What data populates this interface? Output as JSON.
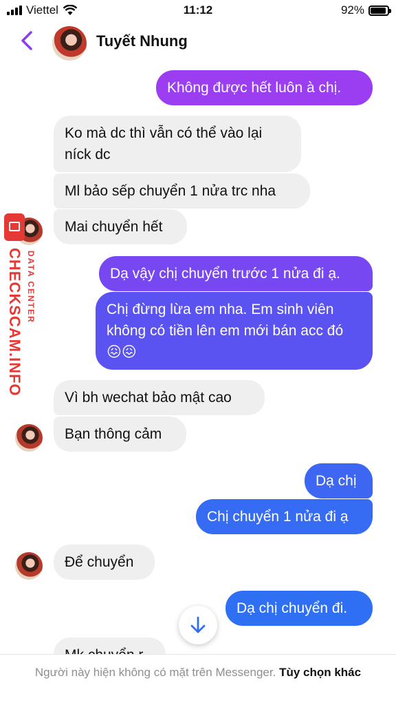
{
  "status_bar": {
    "carrier": "Viettel",
    "time": "11:12",
    "battery": "92%",
    "battery_level": 0.92
  },
  "header": {
    "contact_name": "Tuyết Nhung"
  },
  "watermark": {
    "main": "CHECKSCAM.INFO",
    "sub": "DATA CENTER"
  },
  "messages": [
    "Không được hết luôn à chị.",
    "Ko mà dc thì vẫn có thể vào lại níck dc",
    "Ml bảo sếp chuyển 1 nửa trc nha",
    "Mai chuyển hết",
    "Dạ vậy chị chuyển trước 1 nửa đi ạ.",
    "Chị đừng lừa em nha. Em sinh viên không có tiền lên em mới bán acc đó 😖😖",
    "Vì bh wechat bảo mật cao",
    "Bạn thông cảm",
    "Dạ chị",
    "Chị chuyển 1 nửa đi ạ",
    "Để chuyển",
    "Dạ chị chuyển đi.",
    "Mk chuyển r"
  ],
  "footer": {
    "notice": "Người này hiện không có mặt trên Messenger.",
    "option": "Tùy chọn khác"
  },
  "colors": {
    "outgoing_top": "#9b3ef2",
    "outgoing_mid": "#6a4df0",
    "outgoing_bottom": "#2f6ff3",
    "incoming": "#efefef",
    "accent": "#8a3cf0"
  }
}
